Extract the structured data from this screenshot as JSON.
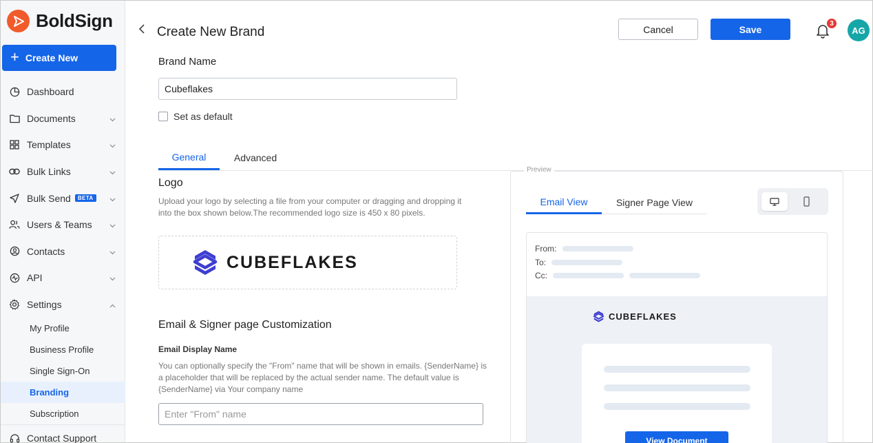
{
  "app": {
    "name": "BoldSign"
  },
  "sidebar": {
    "create_label": "Create New",
    "items": [
      {
        "label": "Dashboard"
      },
      {
        "label": "Documents"
      },
      {
        "label": "Templates"
      },
      {
        "label": "Bulk Links"
      },
      {
        "label": "Bulk Send",
        "badge": "BETA"
      },
      {
        "label": "Users & Teams"
      },
      {
        "label": "Contacts"
      },
      {
        "label": "API"
      },
      {
        "label": "Settings"
      }
    ],
    "settings_sub": [
      {
        "label": "My Profile"
      },
      {
        "label": "Business Profile"
      },
      {
        "label": "Single Sign-On"
      },
      {
        "label": "Branding"
      },
      {
        "label": "Subscription"
      }
    ],
    "support_label": "Contact Support"
  },
  "header": {
    "title": "Create New Brand",
    "cancel_label": "Cancel",
    "save_label": "Save",
    "notification_count": "3",
    "avatar_initials": "AG"
  },
  "form": {
    "brand_name_label": "Brand Name",
    "brand_name_value": "Cubeflakes",
    "default_label": "Set as default",
    "tabs": [
      {
        "label": "General"
      },
      {
        "label": "Advanced"
      }
    ],
    "logo_title": "Logo",
    "logo_desc": "Upload your logo by selecting a file from your computer or dragging and dropping it into the box shown below.The recommended logo size is 450 x 80 pixels.",
    "logo_text": "CUBEFLAKES",
    "custom_title": "Email & Signer page Customization",
    "display_name_label": "Email Display Name",
    "display_name_desc": "You can optionally specify the \"From\" name that will be shown in emails. {SenderName} is a placeholder that will be replaced by the actual sender name. The default value is {SenderName} via Your company name",
    "from_placeholder": "Enter \"From\" name"
  },
  "preview": {
    "legend": "Preview",
    "tabs": [
      {
        "label": "Email View"
      },
      {
        "label": "Signer Page View"
      }
    ],
    "from_label": "From:",
    "to_label": "To:",
    "cc_label": "Cc:",
    "logo_text": "CUBEFLAKES",
    "view_button": "View Document"
  },
  "colors": {
    "accent": "#1565e8",
    "brand": "#f15a2b",
    "logo": "#3f3ed1",
    "avatar": "#17a6a8"
  }
}
